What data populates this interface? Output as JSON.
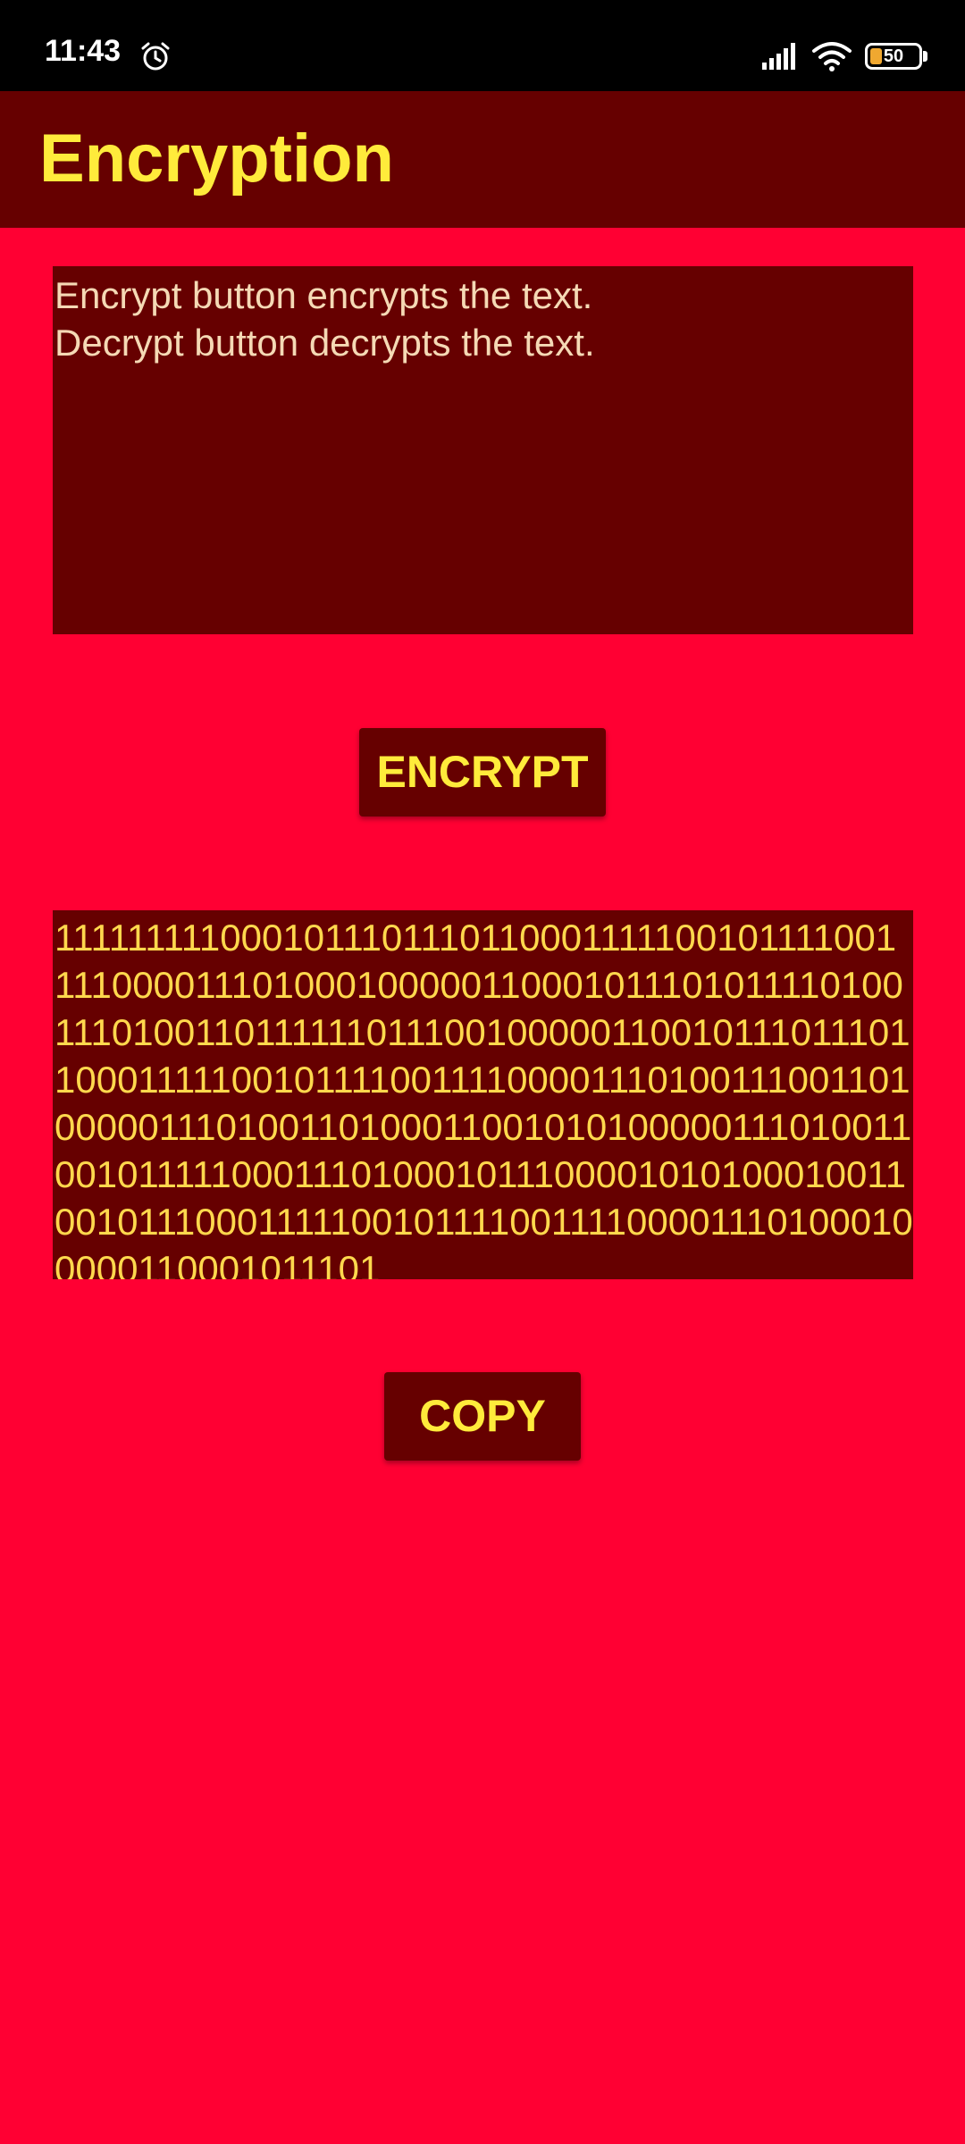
{
  "status_bar": {
    "time": "11:43",
    "battery_level": "50",
    "icons": [
      "alarm-icon",
      "signal-icon",
      "wifi-icon",
      "battery-icon"
    ]
  },
  "app_bar": {
    "title": "Encryption"
  },
  "input": {
    "text": "Encrypt button encrypts the text.\nDecrypt button decrypts the text."
  },
  "encrypt_button": {
    "label": "ENCRYPT"
  },
  "output": {
    "text": "11111111100010111011101100011111001011110011110000111010001000001100010111010111101001110100110111111011100100000110010111011101100011111001011110011110000111010011100110100000111010011010001100101010000011101001100101111100011101000101110000101010001001100101110001111100101111001111000011101000100000110001011101"
  },
  "copy_button": {
    "label": "COPY"
  },
  "colors": {
    "background": "#ff0033",
    "panel": "#660000",
    "accent_text": "#ffeb3b",
    "input_text": "#f5d9b5",
    "status_bar": "#000000"
  }
}
